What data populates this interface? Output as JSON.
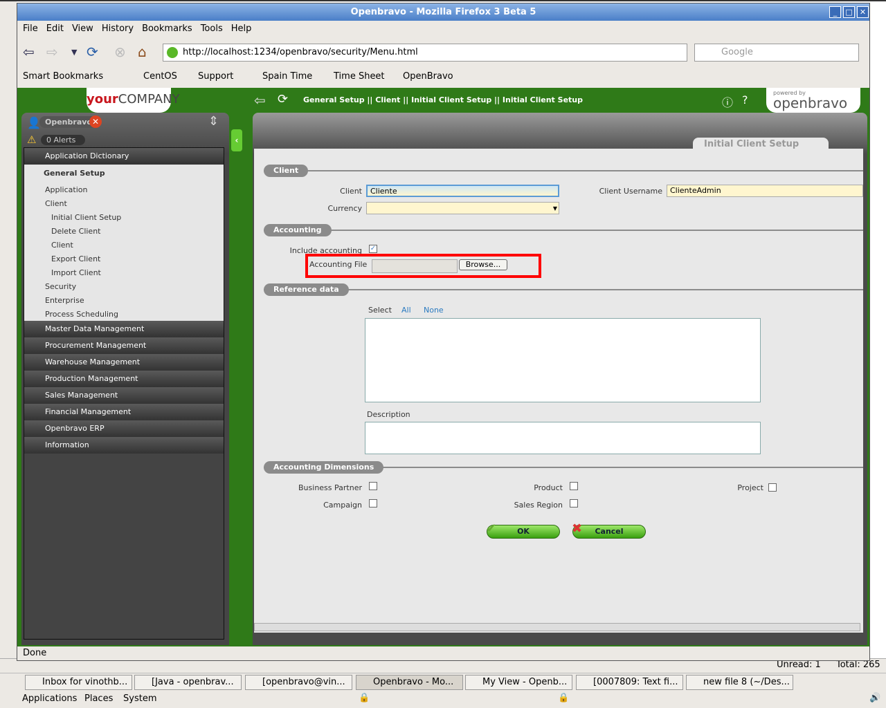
{
  "window": {
    "title": "Openbravo - Mozilla Firefox 3 Beta 5",
    "status": "Done"
  },
  "background_app": {
    "status_unread": "Unread: 1",
    "status_total": "Total: 265"
  },
  "menubar": [
    "File",
    "Edit",
    "View",
    "History",
    "Bookmarks",
    "Tools",
    "Help"
  ],
  "navbar": {
    "url": "http://localhost:1234/openbravo/security/Menu.html",
    "search_placeholder": "Google"
  },
  "bookmarks": [
    "Smart Bookmarks",
    "CentOS",
    "Support",
    "Spain Time",
    "Time Sheet",
    "OpenBravo"
  ],
  "app": {
    "logo": {
      "your": "your",
      "company": "COMPANY"
    },
    "user": "Openbravo",
    "alerts": "0  Alerts",
    "breadcrumb": "General Setup || Client || Initial Client Setup  ||  Initial Client Setup",
    "powered_by": "powered by",
    "brand": "openbravo",
    "tab_title": "Initial Client Setup",
    "menu": {
      "top": "Application Dictionary",
      "open": "General Setup",
      "subitems": [
        "Application",
        "Client",
        "Initial Client Setup",
        "Delete Client",
        "Client",
        "Export Client",
        "Import Client",
        "Security",
        "Enterprise",
        "Process Scheduling"
      ],
      "sections": [
        "Master Data Management",
        "Procurement Management",
        "Warehouse Management",
        "Production Management",
        "Sales Management",
        "Financial Management",
        "Openbravo ERP",
        "Information"
      ]
    },
    "form": {
      "sec_client": "Client",
      "client_label": "Client",
      "client_value": "Cliente",
      "username_label": "Client Username",
      "username_value": "ClienteAdmin",
      "currency_label": "Currency",
      "currency_value": "",
      "sec_accounting": "Accounting",
      "include_label": "Include accounting",
      "include_checked": true,
      "file_label": "Accounting File",
      "browse": "Browse...",
      "sec_reference": "Reference data",
      "select": "Select",
      "all": "All",
      "none": "None",
      "description": "Description",
      "sec_dims": "Accounting Dimensions",
      "dims": [
        "Business Partner",
        "Product",
        "Project",
        "Campaign",
        "Sales Region"
      ],
      "ok": "OK",
      "cancel": "Cancel"
    }
  },
  "taskbar": [
    "Inbox for vinothb...",
    "[Java - openbrav...",
    "[openbravo@vin...",
    "Openbravo - Mo...",
    "My View - Openb...",
    "[0007809: Text fi...",
    "new file 8 (~/Des..."
  ],
  "panel": [
    "Applications",
    "Places",
    "System"
  ],
  "colors": {
    "green": "#2f7a18",
    "highlight": "#ff0000"
  }
}
